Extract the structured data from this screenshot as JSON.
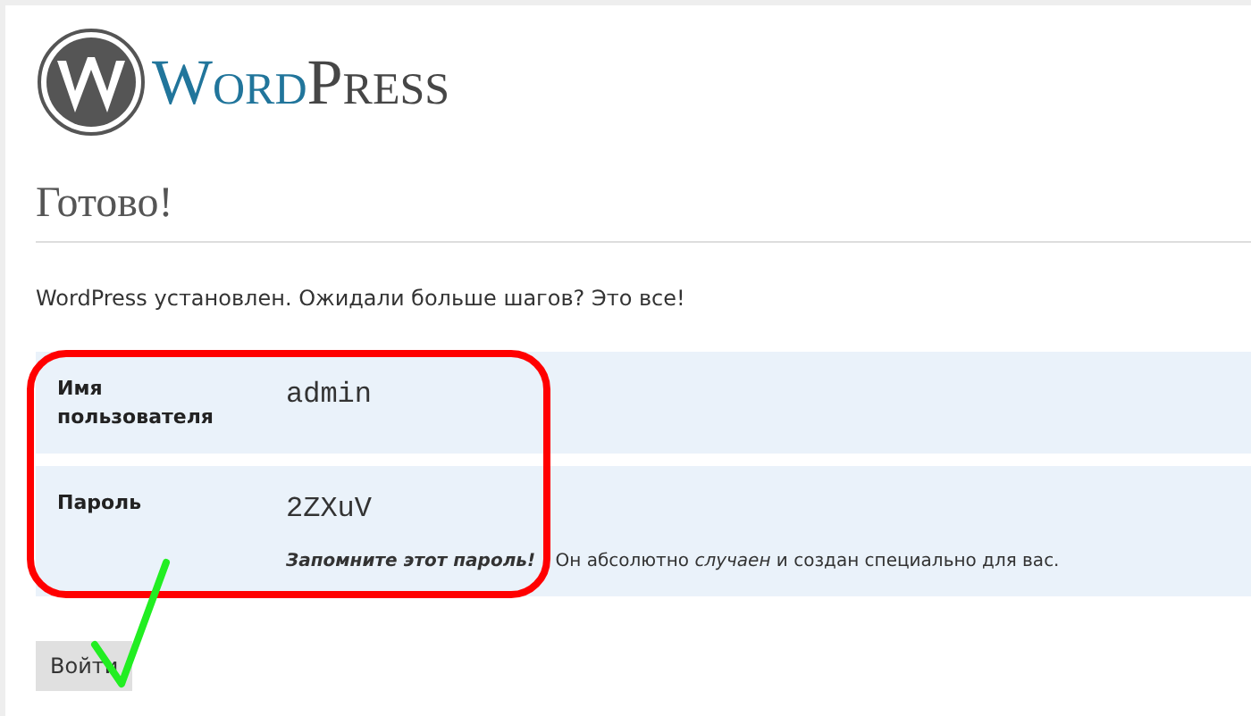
{
  "logo": {
    "part_1": "Word",
    "part_2": "Press"
  },
  "heading": "Готово!",
  "intro": "WordPress установлен. Ожидали больше шагов? Это все!",
  "rows": [
    {
      "label": "Имя пользователя",
      "value": "admin"
    },
    {
      "label": "Пароль",
      "value": "2ZXuV",
      "note": "**Запомните этот пароль!** Он абсолютно *случаен* и создан специально для вас."
    }
  ],
  "button": "Войти"
}
